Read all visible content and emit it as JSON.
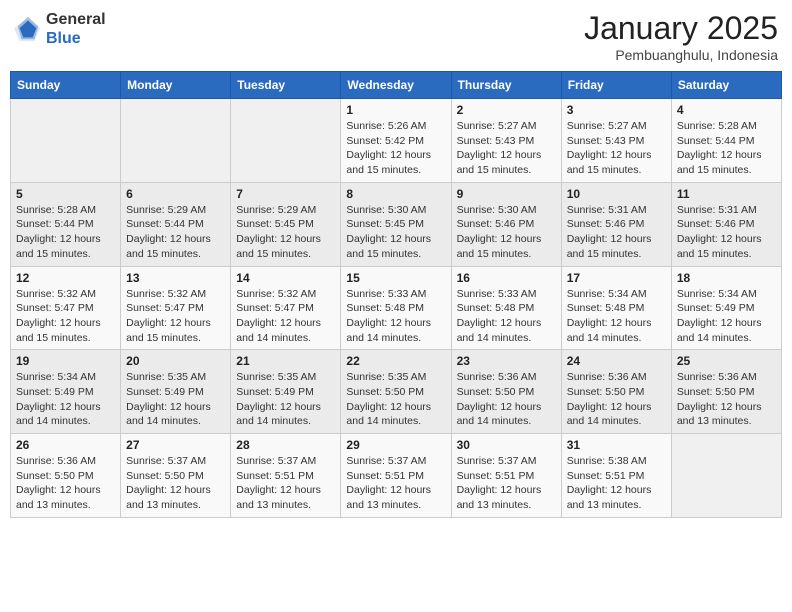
{
  "header": {
    "logo_general": "General",
    "logo_blue": "Blue",
    "month_title": "January 2025",
    "location": "Pembuanghulu, Indonesia"
  },
  "weekdays": [
    "Sunday",
    "Monday",
    "Tuesday",
    "Wednesday",
    "Thursday",
    "Friday",
    "Saturday"
  ],
  "weeks": [
    [
      {
        "day": "",
        "info": ""
      },
      {
        "day": "",
        "info": ""
      },
      {
        "day": "",
        "info": ""
      },
      {
        "day": "1",
        "info": "Sunrise: 5:26 AM\nSunset: 5:42 PM\nDaylight: 12 hours\nand 15 minutes."
      },
      {
        "day": "2",
        "info": "Sunrise: 5:27 AM\nSunset: 5:43 PM\nDaylight: 12 hours\nand 15 minutes."
      },
      {
        "day": "3",
        "info": "Sunrise: 5:27 AM\nSunset: 5:43 PM\nDaylight: 12 hours\nand 15 minutes."
      },
      {
        "day": "4",
        "info": "Sunrise: 5:28 AM\nSunset: 5:44 PM\nDaylight: 12 hours\nand 15 minutes."
      }
    ],
    [
      {
        "day": "5",
        "info": "Sunrise: 5:28 AM\nSunset: 5:44 PM\nDaylight: 12 hours\nand 15 minutes."
      },
      {
        "day": "6",
        "info": "Sunrise: 5:29 AM\nSunset: 5:44 PM\nDaylight: 12 hours\nand 15 minutes."
      },
      {
        "day": "7",
        "info": "Sunrise: 5:29 AM\nSunset: 5:45 PM\nDaylight: 12 hours\nand 15 minutes."
      },
      {
        "day": "8",
        "info": "Sunrise: 5:30 AM\nSunset: 5:45 PM\nDaylight: 12 hours\nand 15 minutes."
      },
      {
        "day": "9",
        "info": "Sunrise: 5:30 AM\nSunset: 5:46 PM\nDaylight: 12 hours\nand 15 minutes."
      },
      {
        "day": "10",
        "info": "Sunrise: 5:31 AM\nSunset: 5:46 PM\nDaylight: 12 hours\nand 15 minutes."
      },
      {
        "day": "11",
        "info": "Sunrise: 5:31 AM\nSunset: 5:46 PM\nDaylight: 12 hours\nand 15 minutes."
      }
    ],
    [
      {
        "day": "12",
        "info": "Sunrise: 5:32 AM\nSunset: 5:47 PM\nDaylight: 12 hours\nand 15 minutes."
      },
      {
        "day": "13",
        "info": "Sunrise: 5:32 AM\nSunset: 5:47 PM\nDaylight: 12 hours\nand 15 minutes."
      },
      {
        "day": "14",
        "info": "Sunrise: 5:32 AM\nSunset: 5:47 PM\nDaylight: 12 hours\nand 14 minutes."
      },
      {
        "day": "15",
        "info": "Sunrise: 5:33 AM\nSunset: 5:48 PM\nDaylight: 12 hours\nand 14 minutes."
      },
      {
        "day": "16",
        "info": "Sunrise: 5:33 AM\nSunset: 5:48 PM\nDaylight: 12 hours\nand 14 minutes."
      },
      {
        "day": "17",
        "info": "Sunrise: 5:34 AM\nSunset: 5:48 PM\nDaylight: 12 hours\nand 14 minutes."
      },
      {
        "day": "18",
        "info": "Sunrise: 5:34 AM\nSunset: 5:49 PM\nDaylight: 12 hours\nand 14 minutes."
      }
    ],
    [
      {
        "day": "19",
        "info": "Sunrise: 5:34 AM\nSunset: 5:49 PM\nDaylight: 12 hours\nand 14 minutes."
      },
      {
        "day": "20",
        "info": "Sunrise: 5:35 AM\nSunset: 5:49 PM\nDaylight: 12 hours\nand 14 minutes."
      },
      {
        "day": "21",
        "info": "Sunrise: 5:35 AM\nSunset: 5:49 PM\nDaylight: 12 hours\nand 14 minutes."
      },
      {
        "day": "22",
        "info": "Sunrise: 5:35 AM\nSunset: 5:50 PM\nDaylight: 12 hours\nand 14 minutes."
      },
      {
        "day": "23",
        "info": "Sunrise: 5:36 AM\nSunset: 5:50 PM\nDaylight: 12 hours\nand 14 minutes."
      },
      {
        "day": "24",
        "info": "Sunrise: 5:36 AM\nSunset: 5:50 PM\nDaylight: 12 hours\nand 14 minutes."
      },
      {
        "day": "25",
        "info": "Sunrise: 5:36 AM\nSunset: 5:50 PM\nDaylight: 12 hours\nand 13 minutes."
      }
    ],
    [
      {
        "day": "26",
        "info": "Sunrise: 5:36 AM\nSunset: 5:50 PM\nDaylight: 12 hours\nand 13 minutes."
      },
      {
        "day": "27",
        "info": "Sunrise: 5:37 AM\nSunset: 5:50 PM\nDaylight: 12 hours\nand 13 minutes."
      },
      {
        "day": "28",
        "info": "Sunrise: 5:37 AM\nSunset: 5:51 PM\nDaylight: 12 hours\nand 13 minutes."
      },
      {
        "day": "29",
        "info": "Sunrise: 5:37 AM\nSunset: 5:51 PM\nDaylight: 12 hours\nand 13 minutes."
      },
      {
        "day": "30",
        "info": "Sunrise: 5:37 AM\nSunset: 5:51 PM\nDaylight: 12 hours\nand 13 minutes."
      },
      {
        "day": "31",
        "info": "Sunrise: 5:38 AM\nSunset: 5:51 PM\nDaylight: 12 hours\nand 13 minutes."
      },
      {
        "day": "",
        "info": ""
      }
    ]
  ]
}
